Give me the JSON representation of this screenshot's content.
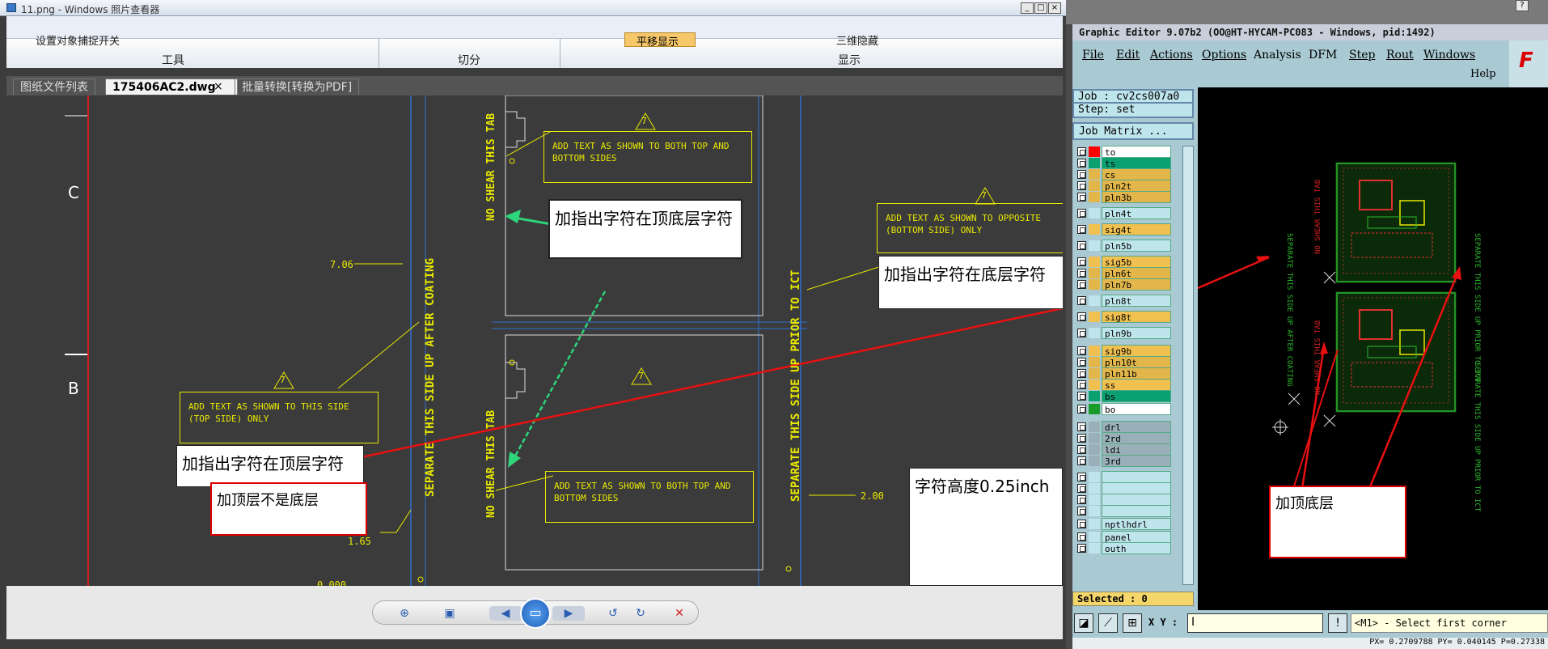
{
  "viewer": {
    "title": "11.png - Windows 照片查看器",
    "ribbon_item_1": "设置对象捕捉开关",
    "ribbon_item_2": "平移显示",
    "ribbon_item_3": "三维隐藏",
    "groups": [
      "工具",
      "切分",
      "显示"
    ],
    "tabs": [
      "图纸文件列表",
      "175406AC2.dwg",
      "批量转换[转换为PDF]"
    ],
    "tab_close": "×"
  },
  "drawing": {
    "zone_c": "C",
    "zone_b": "B",
    "vert_texts": [
      "NO SHEAR THIS TAB",
      "NO SHEAR THIS TAB",
      "SEPARATE THIS SIDE UP AFTER COATING",
      "SEPARATE THIS SIDE UP PRIOR TO ICT",
      "SEPARATE THIS SIDE UP PRIOR TO ICT"
    ],
    "note_top_line1": "ADD TEXT AS SHOWN TO BOTH TOP AND",
    "note_top_line2": "BOTTOM SIDES",
    "note_opp_line1": "ADD TEXT AS SHOWN TO OPPOSITE",
    "note_opp_line2": "(BOTTOM SIDE) ONLY",
    "note_this_line1": "ADD TEXT AS SHOWN TO THIS SIDE",
    "note_this_line2": "(TOP SIDE) ONLY",
    "note_bot_line1": "ADD TEXT AS SHOWN TO BOTH TOP AND",
    "note_bot_line2": "BOTTOM SIDES",
    "flag": "7",
    "dims": [
      "7.06",
      "1.65",
      "2.00",
      "0.000"
    ],
    "callout_topbottom": "加指出字符在顶底层字符",
    "callout_bottom": "加指出字符在底层字符",
    "callout_top": "加指出字符在顶层字符",
    "callout_notbottom": "加顶层不是底层",
    "callout_height": "字符高度0.25inch",
    "callout_right": "加顶底层"
  },
  "player": {
    "icons": [
      "zoom-icon",
      "fit-icon",
      "prev-icon",
      "slideshow-icon",
      "next-icon",
      "rotate-left-icon",
      "rotate-right-icon",
      "delete-icon"
    ]
  },
  "graphic_editor": {
    "title": "Graphic Editor 9.07b2 (OO@HT-HYCAM-PC083 - Windows, pid:1492)",
    "menu": [
      "File",
      "Edit",
      "Actions",
      "Options",
      "Analysis",
      "DFM",
      "Step",
      "Rout",
      "Windows"
    ],
    "help": "Help",
    "logo": "F",
    "job": "Job : cv2cs007a0",
    "step": "Step: set",
    "job_matrix": "Job Matrix ...",
    "layers": [
      {
        "name": "to",
        "color": "#ff0000",
        "bg": "#ffffff"
      },
      {
        "name": "ts",
        "color": "#0aa070",
        "bg": "#0aa070"
      },
      {
        "name": "cs",
        "color": "#e2b64a",
        "bg": "#e2b64a"
      },
      {
        "name": "pln2t",
        "color": "#e2b64a",
        "bg": "#e2b64a"
      },
      {
        "name": "pln3b",
        "color": "#e2b64a",
        "bg": "#e2b64a"
      },
      {
        "name": "pln4t",
        "color": "#bfe5ec",
        "bg": "#bfe5ec"
      },
      {
        "name": "sig4t",
        "color": "#f0c050",
        "bg": "#f0c050"
      },
      {
        "name": "pln5b",
        "color": "#bfe5ec",
        "bg": "#bfe5ec"
      },
      {
        "name": "sig5b",
        "color": "#f0c050",
        "bg": "#f0c050"
      },
      {
        "name": "pln6t",
        "color": "#e2b64a",
        "bg": "#e2b64a"
      },
      {
        "name": "pln7b",
        "color": "#e2b64a",
        "bg": "#e2b64a"
      },
      {
        "name": "pln8t",
        "color": "#bfe5ec",
        "bg": "#bfe5ec"
      },
      {
        "name": "sig8t",
        "color": "#f0c050",
        "bg": "#f0c050"
      },
      {
        "name": "pln9b",
        "color": "#bfe5ec",
        "bg": "#bfe5ec"
      },
      {
        "name": "sig9b",
        "color": "#f0c050",
        "bg": "#f0c050"
      },
      {
        "name": "pln10t",
        "color": "#e2b64a",
        "bg": "#e2b64a"
      },
      {
        "name": "pln11b",
        "color": "#e2b64a",
        "bg": "#e2b64a"
      },
      {
        "name": "ss",
        "color": "#f0c050",
        "bg": "#f0c050"
      },
      {
        "name": "bs",
        "color": "#0aa070",
        "bg": "#0aa070"
      },
      {
        "name": "bo",
        "color": "#1a9c2a",
        "bg": "#ffffff"
      },
      {
        "name": "drl",
        "color": "#9ab0b8",
        "bg": "#9ab0b8"
      },
      {
        "name": "2rd",
        "color": "#9ab0b8",
        "bg": "#9ab0b8"
      },
      {
        "name": "ldi",
        "color": "#9ab0b8",
        "bg": "#9ab0b8"
      },
      {
        "name": "3rd",
        "color": "#9ab0b8",
        "bg": "#9ab0b8"
      },
      {
        "name": "",
        "color": "#bfe5ec",
        "bg": "#bfe5ec"
      },
      {
        "name": "",
        "color": "#bfe5ec",
        "bg": "#bfe5ec"
      },
      {
        "name": "",
        "color": "#bfe5ec",
        "bg": "#bfe5ec"
      },
      {
        "name": "",
        "color": "#bfe5ec",
        "bg": "#bfe5ec"
      },
      {
        "name": "nptlhdrl",
        "color": "#bfe5ec",
        "bg": "#bfe5ec"
      },
      {
        "name": "panel",
        "color": "#bfe5ec",
        "bg": "#bfe5ec"
      },
      {
        "name": "outh",
        "color": "#bfe5ec",
        "bg": "#bfe5ec"
      }
    ],
    "selected": "Selected : 0",
    "xy_label": "X Y :",
    "xy_value": "I",
    "status": "<M1> - Select first corner",
    "coords": "PX= 0.2709788 PY= 0.040145 P=0.27338"
  }
}
